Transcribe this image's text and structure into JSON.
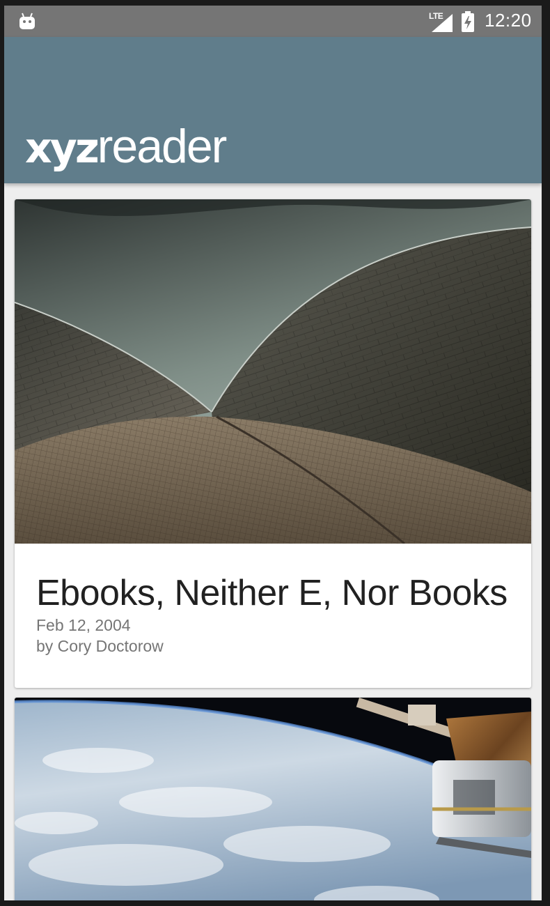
{
  "status_bar": {
    "network_type": "LTE",
    "time": "12:20"
  },
  "app_bar": {
    "logo_bold": "xyz",
    "logo_light": "reader",
    "color": "#607d8b"
  },
  "articles": [
    {
      "title": "Ebooks, Neither E, Nor Books",
      "date": "Feb 12, 2004",
      "author": "by Cory Doctorow",
      "image": "sydney-opera-house-roof-photo"
    },
    {
      "title": "",
      "date": "",
      "author": "",
      "image": "earth-orbit-satellite-photo"
    }
  ],
  "icons": {
    "android": "android-debug-icon",
    "signal": "cell-signal-icon",
    "battery": "battery-charging-icon"
  }
}
